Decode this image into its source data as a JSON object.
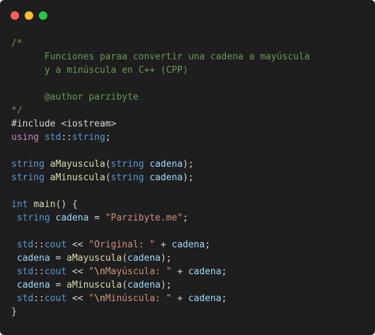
{
  "window": {
    "controls": [
      {
        "name": "close",
        "color": "#ff5f56"
      },
      {
        "name": "minimize",
        "color": "#ffbd2e"
      },
      {
        "name": "maximize",
        "color": "#27c93f"
      }
    ]
  },
  "colors": {
    "background": "#1e1e1e",
    "comment": "#6a9955",
    "keyword": "#c586c0",
    "type": "#569cd6",
    "function": "#dcdcaa",
    "variable": "#9cdcfe",
    "string": "#ce9178",
    "default": "#d4d4d4"
  },
  "code": {
    "lines": [
      [
        [
          "comment",
          "/*"
        ]
      ],
      [
        [
          "comment",
          "      Funciones paraa convertir una cadena a mayúscula"
        ]
      ],
      [
        [
          "comment",
          "      y a minúscula en C++ (CPP)"
        ]
      ],
      [
        [
          "comment",
          ""
        ]
      ],
      [
        [
          "comment",
          "      @author parzibyte"
        ]
      ],
      [
        [
          "comment",
          "*/"
        ]
      ],
      [
        [
          "default",
          "#include <iostream>"
        ]
      ],
      [
        [
          "keyword",
          "using"
        ],
        [
          "default",
          " "
        ],
        [
          "type",
          "std"
        ],
        [
          "operator",
          "::"
        ],
        [
          "type",
          "string"
        ],
        [
          "default",
          ";"
        ]
      ],
      [],
      [
        [
          "type",
          "string"
        ],
        [
          "default",
          " "
        ],
        [
          "function",
          "aMayuscula"
        ],
        [
          "default",
          "("
        ],
        [
          "type",
          "string"
        ],
        [
          "default",
          " "
        ],
        [
          "variable",
          "cadena"
        ],
        [
          "default",
          ");"
        ]
      ],
      [
        [
          "type",
          "string"
        ],
        [
          "default",
          " "
        ],
        [
          "function",
          "aMinuscula"
        ],
        [
          "default",
          "("
        ],
        [
          "type",
          "string"
        ],
        [
          "default",
          " "
        ],
        [
          "variable",
          "cadena"
        ],
        [
          "default",
          ");"
        ]
      ],
      [],
      [
        [
          "type",
          "int"
        ],
        [
          "default",
          " "
        ],
        [
          "function",
          "main"
        ],
        [
          "default",
          "() {"
        ]
      ],
      [
        [
          "default",
          " "
        ],
        [
          "type",
          "string"
        ],
        [
          "default",
          " "
        ],
        [
          "variable",
          "cadena"
        ],
        [
          "default",
          " = "
        ],
        [
          "string",
          "\"Parzibyte.me\""
        ],
        [
          "default",
          ";"
        ]
      ],
      [],
      [
        [
          "default",
          " "
        ],
        [
          "type",
          "std"
        ],
        [
          "operator",
          "::"
        ],
        [
          "type",
          "cout"
        ],
        [
          "default",
          " << "
        ],
        [
          "string",
          "\"Original: \""
        ],
        [
          "default",
          " + "
        ],
        [
          "variable",
          "cadena"
        ],
        [
          "default",
          ";"
        ]
      ],
      [
        [
          "default",
          " "
        ],
        [
          "variable",
          "cadena"
        ],
        [
          "default",
          " = "
        ],
        [
          "function",
          "aMayuscula"
        ],
        [
          "default",
          "("
        ],
        [
          "variable",
          "cadena"
        ],
        [
          "default",
          ");"
        ]
      ],
      [
        [
          "default",
          " "
        ],
        [
          "type",
          "std"
        ],
        [
          "operator",
          "::"
        ],
        [
          "type",
          "cout"
        ],
        [
          "default",
          " << "
        ],
        [
          "string",
          "\""
        ],
        [
          "escape",
          "\\n"
        ],
        [
          "string",
          "Mayúscula: \""
        ],
        [
          "default",
          " + "
        ],
        [
          "variable",
          "cadena"
        ],
        [
          "default",
          ";"
        ]
      ],
      [
        [
          "default",
          " "
        ],
        [
          "variable",
          "cadena"
        ],
        [
          "default",
          " = "
        ],
        [
          "function",
          "aMinuscula"
        ],
        [
          "default",
          "("
        ],
        [
          "variable",
          "cadena"
        ],
        [
          "default",
          ");"
        ]
      ],
      [
        [
          "default",
          " "
        ],
        [
          "type",
          "std"
        ],
        [
          "operator",
          "::"
        ],
        [
          "type",
          "cout"
        ],
        [
          "default",
          " << "
        ],
        [
          "string",
          "\""
        ],
        [
          "escape",
          "\\n"
        ],
        [
          "string",
          "Minúscula: \""
        ],
        [
          "default",
          " + "
        ],
        [
          "variable",
          "cadena"
        ],
        [
          "default",
          ";"
        ]
      ],
      [
        [
          "default",
          "}"
        ]
      ]
    ]
  }
}
